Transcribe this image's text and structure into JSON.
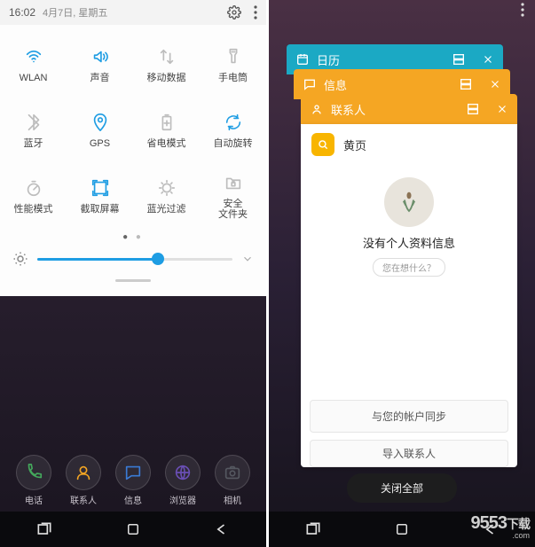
{
  "left": {
    "status": {
      "time": "16:02",
      "date": "4月7日, 星期五"
    },
    "tiles": [
      {
        "label": "WLAN",
        "state": "on",
        "icon": "wifi-icon"
      },
      {
        "label": "声音",
        "state": "on",
        "icon": "sound-icon"
      },
      {
        "label": "移动数据",
        "state": "off",
        "icon": "data-icon"
      },
      {
        "label": "手电筒",
        "state": "off",
        "icon": "flashlight-icon"
      },
      {
        "label": "蓝牙",
        "state": "off",
        "icon": "bluetooth-icon"
      },
      {
        "label": "GPS",
        "state": "on",
        "icon": "gps-icon"
      },
      {
        "label": "省电模式",
        "state": "off",
        "icon": "battery-saver-icon"
      },
      {
        "label": "自动旋转",
        "state": "on",
        "icon": "rotate-icon"
      },
      {
        "label": "性能模式",
        "state": "off",
        "icon": "performance-icon"
      },
      {
        "label": "截取屏幕",
        "state": "on",
        "icon": "screenshot-icon"
      },
      {
        "label": "蓝光过滤",
        "state": "off",
        "icon": "bluelight-icon"
      },
      {
        "label": "安全\n文件夹",
        "state": "off",
        "icon": "secure-folder-icon"
      }
    ],
    "brightness_percent": 62,
    "dock": [
      {
        "label": "电话",
        "color": "#44a85c",
        "icon": "phone-icon"
      },
      {
        "label": "联系人",
        "color": "#f5a623",
        "icon": "contacts-icon"
      },
      {
        "label": "信息",
        "color": "#3a7bd5",
        "icon": "messages-icon"
      },
      {
        "label": "浏览器",
        "color": "#6a4fb5",
        "icon": "browser-icon"
      },
      {
        "label": "相机",
        "color": "#555860",
        "icon": "camera-icon"
      }
    ]
  },
  "right": {
    "cards": [
      {
        "title": "日历",
        "color": "#1ba9c4",
        "icon": "calendar-icon"
      },
      {
        "title": "信息",
        "color": "#f5a623",
        "icon": "messages-icon"
      },
      {
        "title": "联系人",
        "color": "#f5a623",
        "icon": "contacts-icon"
      }
    ],
    "yellow_pages": "黄页",
    "no_profile": "没有个人资料信息",
    "prompt_pill": "您在想什么？",
    "sync_btn": "与您的帐户同步",
    "import_btn": "导入联系人",
    "close_all": "关闭全部"
  },
  "watermark": {
    "brand": "9553",
    "suffix": "下载",
    "domain": ".com"
  }
}
